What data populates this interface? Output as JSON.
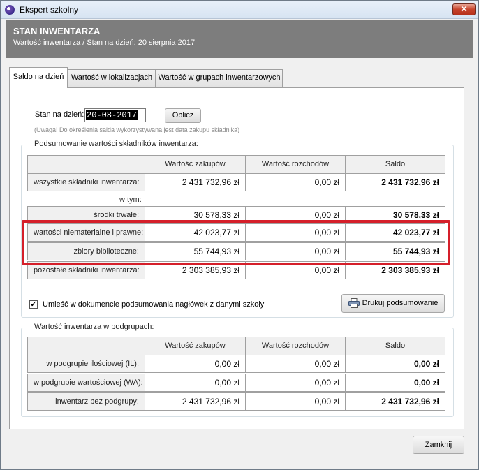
{
  "window": {
    "title": "Ekspert szkolny",
    "close_glyph": "✕"
  },
  "header": {
    "title": "STAN INWENTARZA",
    "subtitle": "Wartość inwentarza / Stan na dzień: 20 sierpnia 2017"
  },
  "tabs": [
    {
      "label": "Saldo na dzień",
      "active": true
    },
    {
      "label": "Wartość w lokalizacjach",
      "active": false
    },
    {
      "label": "Wartość w grupach inwentarzowych",
      "active": false
    }
  ],
  "date_form": {
    "label": "Stan na dzień:",
    "value": "20-08-2017",
    "calc_button": "Oblicz",
    "note": "(Uwaga! Do określenia salda wykorzystywana jest data zakupu składnika)"
  },
  "summary": {
    "legend": "Podsumowanie wartości składników inwentarza:",
    "columns": [
      "Wartość zakupów",
      "Wartość rozchodów",
      "Saldo"
    ],
    "all_row": {
      "label": "wszystkie składniki inwentarza:",
      "purchases": "2 431 732,96 zł",
      "disposals": "0,00 zł",
      "balance": "2 431 732,96 zł"
    },
    "in_that_label": "w tym:",
    "rows": [
      {
        "label": "środki trwałe:",
        "purchases": "30 578,33 zł",
        "disposals": "0,00 zł",
        "balance": "30 578,33 zł"
      },
      {
        "label": "wartości niematerialne i prawne:",
        "purchases": "42 023,77 zł",
        "disposals": "0,00 zł",
        "balance": "42 023,77 zł"
      },
      {
        "label": "zbiory biblioteczne:",
        "purchases": "55 744,93 zł",
        "disposals": "0,00 zł",
        "balance": "55 744,93 zł"
      },
      {
        "label": "pozostałe składniki inwentarza:",
        "purchases": "2 303 385,93 zł",
        "disposals": "0,00 zł",
        "balance": "2 303 385,93 zł"
      }
    ],
    "header_checkbox_label": "Umieść w dokumencie podsumowania nagłówek z danymi szkoły",
    "header_checkbox_checked": true,
    "print_button": "Drukuj podsumowanie"
  },
  "subgroups": {
    "legend": "Wartość inwentarza w podgrupach:",
    "columns": [
      "Wartość zakupów",
      "Wartość rozchodów",
      "Saldo"
    ],
    "rows": [
      {
        "label": "w podgrupie ilościowej (IL):",
        "purchases": "0,00 zł",
        "disposals": "0,00 zł",
        "balance": "0,00 zł"
      },
      {
        "label": "w podgrupie wartościowej (WA):",
        "purchases": "0,00 zł",
        "disposals": "0,00 zł",
        "balance": "0,00 zł"
      },
      {
        "label": "inwentarz bez podgrupy:",
        "purchases": "2 431 732,96 zł",
        "disposals": "0,00 zł",
        "balance": "2 431 732,96 zł"
      }
    ]
  },
  "footer": {
    "close_button": "Zamknij"
  },
  "colors": {
    "highlight": "#d51f2a",
    "header_bg": "#7d7d7d"
  },
  "icons": {
    "app": "app-logo-icon",
    "print": "printer-icon",
    "close": "close-icon"
  }
}
